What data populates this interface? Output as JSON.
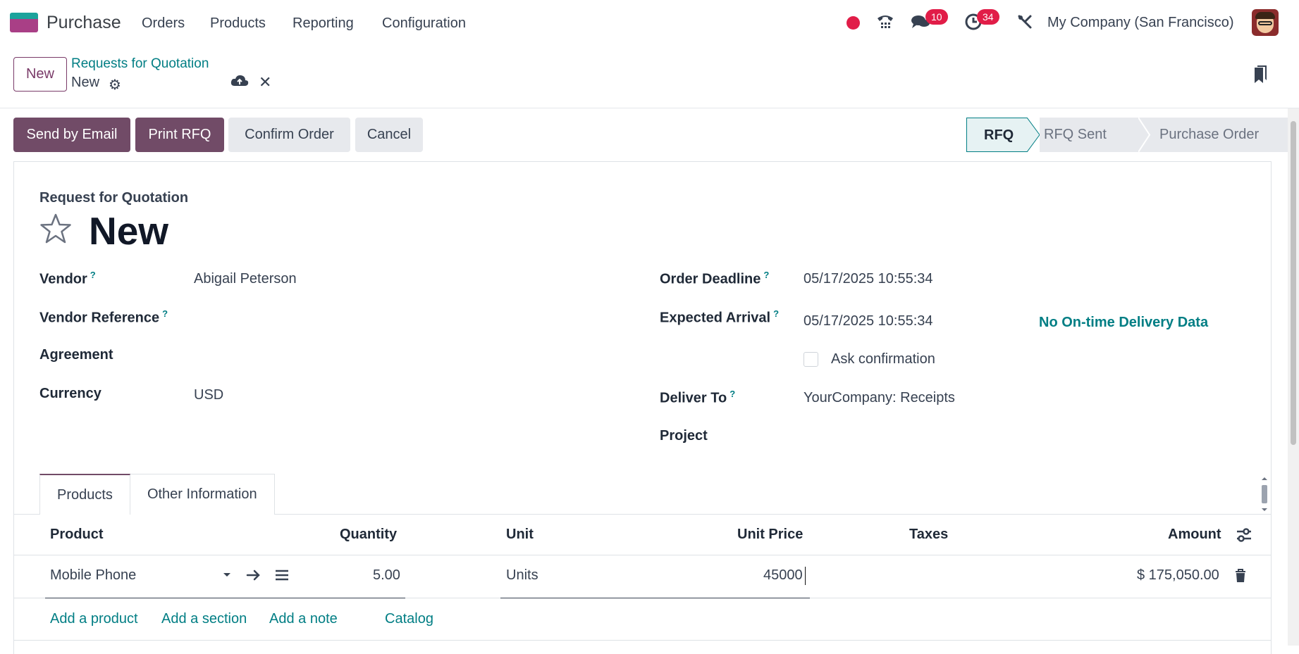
{
  "navbar": {
    "app_name": "Purchase",
    "menu": [
      "Orders",
      "Products",
      "Reporting",
      "Configuration"
    ],
    "messages_count": "10",
    "activities_count": "34",
    "company": "My Company (San Francisco)"
  },
  "control_panel": {
    "new_button": "New",
    "breadcrumb_parent": "Requests for Quotation",
    "breadcrumb_current": "New"
  },
  "actions": {
    "send_email": "Send by Email",
    "print_rfq": "Print RFQ",
    "confirm_order": "Confirm Order",
    "cancel": "Cancel"
  },
  "statusbar": [
    "RFQ",
    "RFQ Sent",
    "Purchase Order"
  ],
  "form": {
    "doc_type": "Request for Quotation",
    "record_name": "New",
    "left_fields": [
      {
        "label": "Vendor",
        "help": "?",
        "value": "Abigail Peterson"
      },
      {
        "label": "Vendor Reference",
        "help": "?",
        "value": ""
      },
      {
        "label": "Agreement",
        "help": "",
        "value": ""
      },
      {
        "label": "Currency",
        "help": "",
        "value": "USD"
      }
    ],
    "right_fields": [
      {
        "label": "Order Deadline",
        "help": "?",
        "value": "05/17/2025 10:55:34"
      },
      {
        "label": "Expected Arrival",
        "help": "?",
        "value": "05/17/2025 10:55:34"
      },
      {
        "label": "Deliver To",
        "help": "?",
        "value": "YourCompany: Receipts"
      },
      {
        "label": "Project",
        "help": "",
        "value": ""
      }
    ],
    "ontime_text": "No On-time Delivery Data",
    "ask_confirmation": "Ask confirmation"
  },
  "tabs": [
    "Products",
    "Other Information"
  ],
  "table": {
    "headers": [
      "Product",
      "Quantity",
      "Unit",
      "Unit Price",
      "Taxes",
      "Amount"
    ],
    "rows": [
      {
        "product": "Mobile Phone",
        "quantity": "5.00",
        "unit": "Units",
        "unit_price": "45000",
        "taxes": "",
        "amount": "$ 175,050.00"
      }
    ],
    "add_links": [
      "Add a product",
      "Add a section",
      "Add a note",
      "Catalog"
    ]
  },
  "colors": {
    "brand": "#714b67",
    "link": "#017e84",
    "badge": "#e11d48"
  }
}
